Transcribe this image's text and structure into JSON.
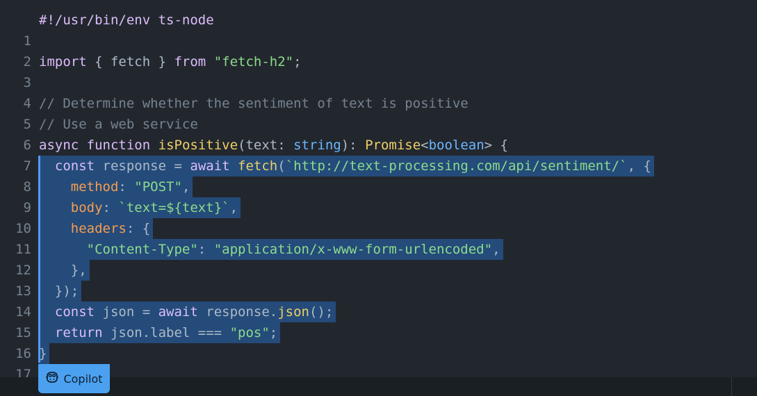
{
  "editor": {
    "lines": [
      {
        "n": "1"
      },
      {
        "n": "2"
      },
      {
        "n": "3"
      },
      {
        "n": "4"
      },
      {
        "n": "5"
      },
      {
        "n": "6"
      },
      {
        "n": "7"
      },
      {
        "n": "8"
      },
      {
        "n": "9"
      },
      {
        "n": "10"
      },
      {
        "n": "11"
      },
      {
        "n": "12"
      },
      {
        "n": "13"
      },
      {
        "n": "14"
      },
      {
        "n": "15"
      },
      {
        "n": "16"
      },
      {
        "n": "17"
      }
    ],
    "tokens": {
      "l1": "#!/usr/bin/env ts-node",
      "l3_import": "import",
      "l3_mid": " { fetch } ",
      "l3_from": "from",
      "l3_str": "\"fetch-h2\"",
      "l3_end": ";",
      "l5": "// Determine whether the sentiment of text is positive",
      "l6": "// Use a web service",
      "l7_async": "async",
      "l7_function": "function",
      "l7_name": "isPositive",
      "l7_params_open": "(text: ",
      "l7_type": "string",
      "l7_params_close": "): ",
      "l7_promise": "Promise",
      "l7_lt": "<",
      "l7_bool": "boolean",
      "l7_gt": "> {",
      "l8_const": "const",
      "l8_var": " response = ",
      "l8_await": "await",
      "l8_fetch": "fetch",
      "l8_open": "(",
      "l8_url": "`http://text-processing.com/api/sentiment/`",
      "l8_end": ", {",
      "l9_key": "method",
      "l9_colon": ": ",
      "l9_val": "\"POST\"",
      "l9_end": ",",
      "l10_key": "body",
      "l10_colon": ": ",
      "l10_val": "`text=${text}`",
      "l10_end": ",",
      "l11_key": "headers",
      "l11_end": ": {",
      "l12_key": "\"Content-Type\"",
      "l12_colon": ": ",
      "l12_val": "\"application/x-www-form-urlencoded\"",
      "l12_end": ",",
      "l13": "},",
      "l14": "});",
      "l15_const": "const",
      "l15_mid": " json = ",
      "l15_await": "await",
      "l15_resp": " response.",
      "l15_json": "json",
      "l15_end": "();",
      "l16_return": "return",
      "l16_mid": " json.label === ",
      "l16_str": "\"pos\"",
      "l16_end": ";",
      "l17": "}"
    }
  },
  "copilot": {
    "label": "Copilot",
    "icon": "copilot-icon",
    "color": "#4ba1f0"
  }
}
